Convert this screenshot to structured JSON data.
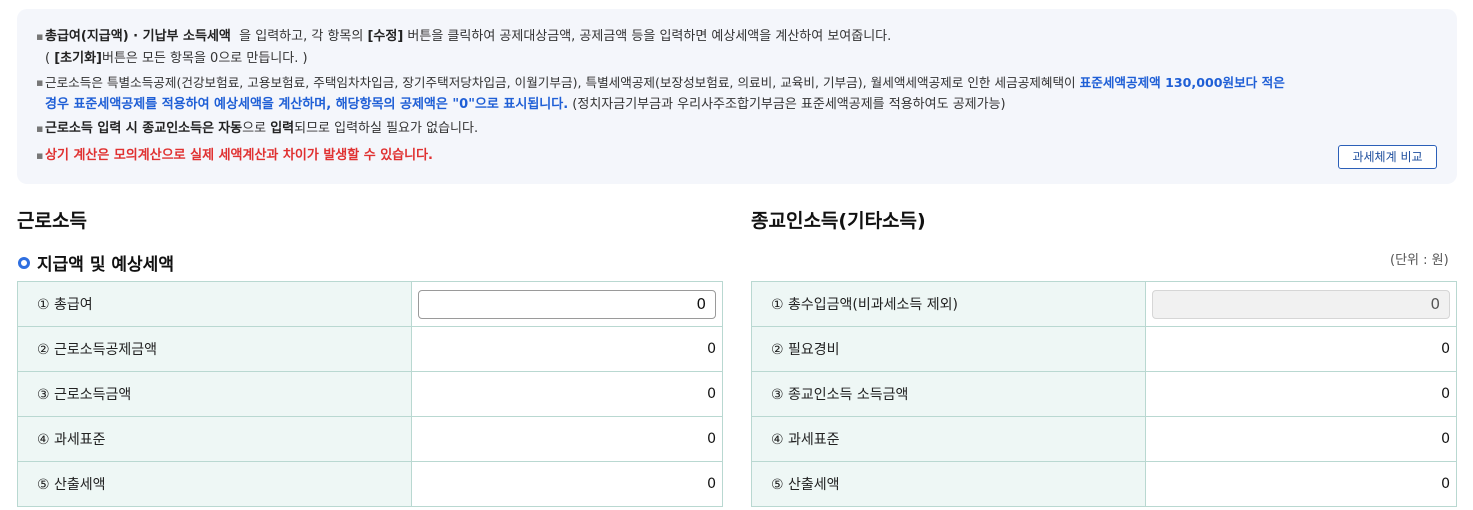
{
  "notice": {
    "line1": {
      "bold1": "총급여(지급액) · 기납부 소득세액",
      "text1": "을 입력하고, 각 항목의",
      "bold2": "[수정]",
      "text2": "버튼을 클릭하여 공제대상금액, 공제금액 등을 입력하면 예상세액을 계산하여 보여줍니다."
    },
    "line2": {
      "pre": "(",
      "bold": "[초기화]",
      "text": "버튼은 모든 항목을 0으로 만듭니다. )"
    },
    "line3": {
      "text": "근로소득은 특별소득공제(건강보험료, 고용보험료, 주택임차차입금, 장기주택저당차입금, 이월기부금), 특별세액공제(보장성보험료, 의료비, 교육비, 기부금), 월세액세액공제로 인한 세금공제혜택이",
      "blue": "표준세액공제액 130,000원보다 적은"
    },
    "line4": {
      "blue": "경우 표준세액공제를 적용하여 예상세액을 계산하며, 해당항목의 공제액은 \"0\"으로 표시됩니다.",
      "text": "(정치자금기부금과 우리사주조합기부금은 표준세액공제를 적용하여도 공제가능)"
    },
    "line5": {
      "bold1": "근로소득 입력 시 종교인소득은",
      "bold2": "자동",
      "text1": "으로",
      "bold3": "입력",
      "text2": "되므로 입력하실 필요가 없습니다."
    },
    "line6": {
      "red": "상기 계산은 모의계산으로 실제 세액계산과 차이가 발생할 수 있습니다."
    },
    "compare_button": "과세체계 비교"
  },
  "left": {
    "title": "근로소득",
    "subtitle": "지급액 및 예상세액",
    "rows": [
      {
        "label": "① 총급여",
        "value": "0"
      },
      {
        "label": "② 근로소득공제금액",
        "value": "0"
      },
      {
        "label": "③ 근로소득금액",
        "value": "0"
      },
      {
        "label": "④ 과세표준",
        "value": "0"
      },
      {
        "label": "⑤ 산출세액",
        "value": "0"
      }
    ]
  },
  "right": {
    "title": "종교인소득(기타소득)",
    "unit": "(단위 : 원)",
    "rows": [
      {
        "label": "① 총수입금액(비과세소득 제외)",
        "value": "0"
      },
      {
        "label": "② 필요경비",
        "value": "0"
      },
      {
        "label": "③ 종교인소득 소득금액",
        "value": "0"
      },
      {
        "label": "④ 과세표준",
        "value": "0"
      },
      {
        "label": "⑤ 산출세액",
        "value": "0"
      }
    ]
  },
  "colors": {
    "accent": "#2f6fe0",
    "blue_text": "#1f5fd6",
    "red_text": "#e03131",
    "label_bg": "#eef7f5",
    "border": "#b9d8d1"
  }
}
